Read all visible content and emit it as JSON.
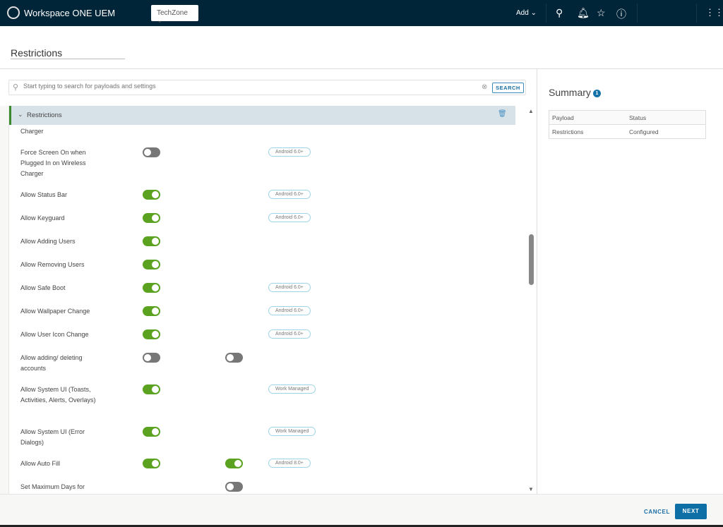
{
  "header": {
    "app_title": "Workspace ONE UEM",
    "org": "TechZone",
    "add_label": "Add",
    "icons": [
      "search-icon",
      "bell-icon",
      "star-icon",
      "help-icon",
      "app-grid-icon"
    ]
  },
  "page": {
    "title": "Restrictions"
  },
  "search": {
    "placeholder": "Start typing to search for payloads and settings",
    "button": "SEARCH"
  },
  "section": {
    "title": "Restrictions"
  },
  "partial_label": "Charger",
  "rows": [
    {
      "label": "Force Screen On when Plugged In on Wireless Charger",
      "t1": false,
      "t2": null,
      "badge": "Android 6.0+"
    },
    {
      "label": "Allow Status Bar",
      "t1": true,
      "t2": null,
      "badge": "Android 6.0+"
    },
    {
      "label": "Allow Keyguard",
      "t1": true,
      "t2": null,
      "badge": "Android 6.0+"
    },
    {
      "label": "Allow Adding Users",
      "t1": true,
      "t2": null,
      "badge": ""
    },
    {
      "label": "Allow Removing Users",
      "t1": true,
      "t2": null,
      "badge": ""
    },
    {
      "label": "Allow Safe Boot",
      "t1": true,
      "t2": null,
      "badge": "Android 6.0+"
    },
    {
      "label": "Allow Wallpaper Change",
      "t1": true,
      "t2": null,
      "badge": "Android 6.0+"
    },
    {
      "label": "Allow User Icon Change",
      "t1": true,
      "t2": null,
      "badge": "Android 6.0+"
    },
    {
      "label": "Allow adding/ deleting accounts",
      "t1": false,
      "t2": false,
      "badge": ""
    },
    {
      "label": "Allow System UI (Toasts, Activities, Alerts, Overlays)",
      "t1": true,
      "t2": null,
      "badge": "Work Managed"
    },
    {
      "label": "Allow System UI (Error Dialogs)",
      "t1": true,
      "t2": null,
      "badge": "Work Managed"
    },
    {
      "label": "Allow Auto Fill",
      "t1": true,
      "t2": true,
      "badge": "Android 8.0+"
    },
    {
      "label": "Set Maximum Days for Disabling Work Profile",
      "t1": null,
      "t2": false,
      "badge": ""
    }
  ],
  "summary": {
    "title": "Summary",
    "count": "1",
    "columns": [
      "Payload",
      "Status"
    ],
    "rows": [
      [
        "Restrictions",
        "Configured"
      ]
    ]
  },
  "footer": {
    "cancel": "CANCEL",
    "next": "NEXT"
  },
  "colors": {
    "header_bg": "#002538",
    "toggle_on": "#5aa220",
    "primary": "#0d6fa6"
  }
}
